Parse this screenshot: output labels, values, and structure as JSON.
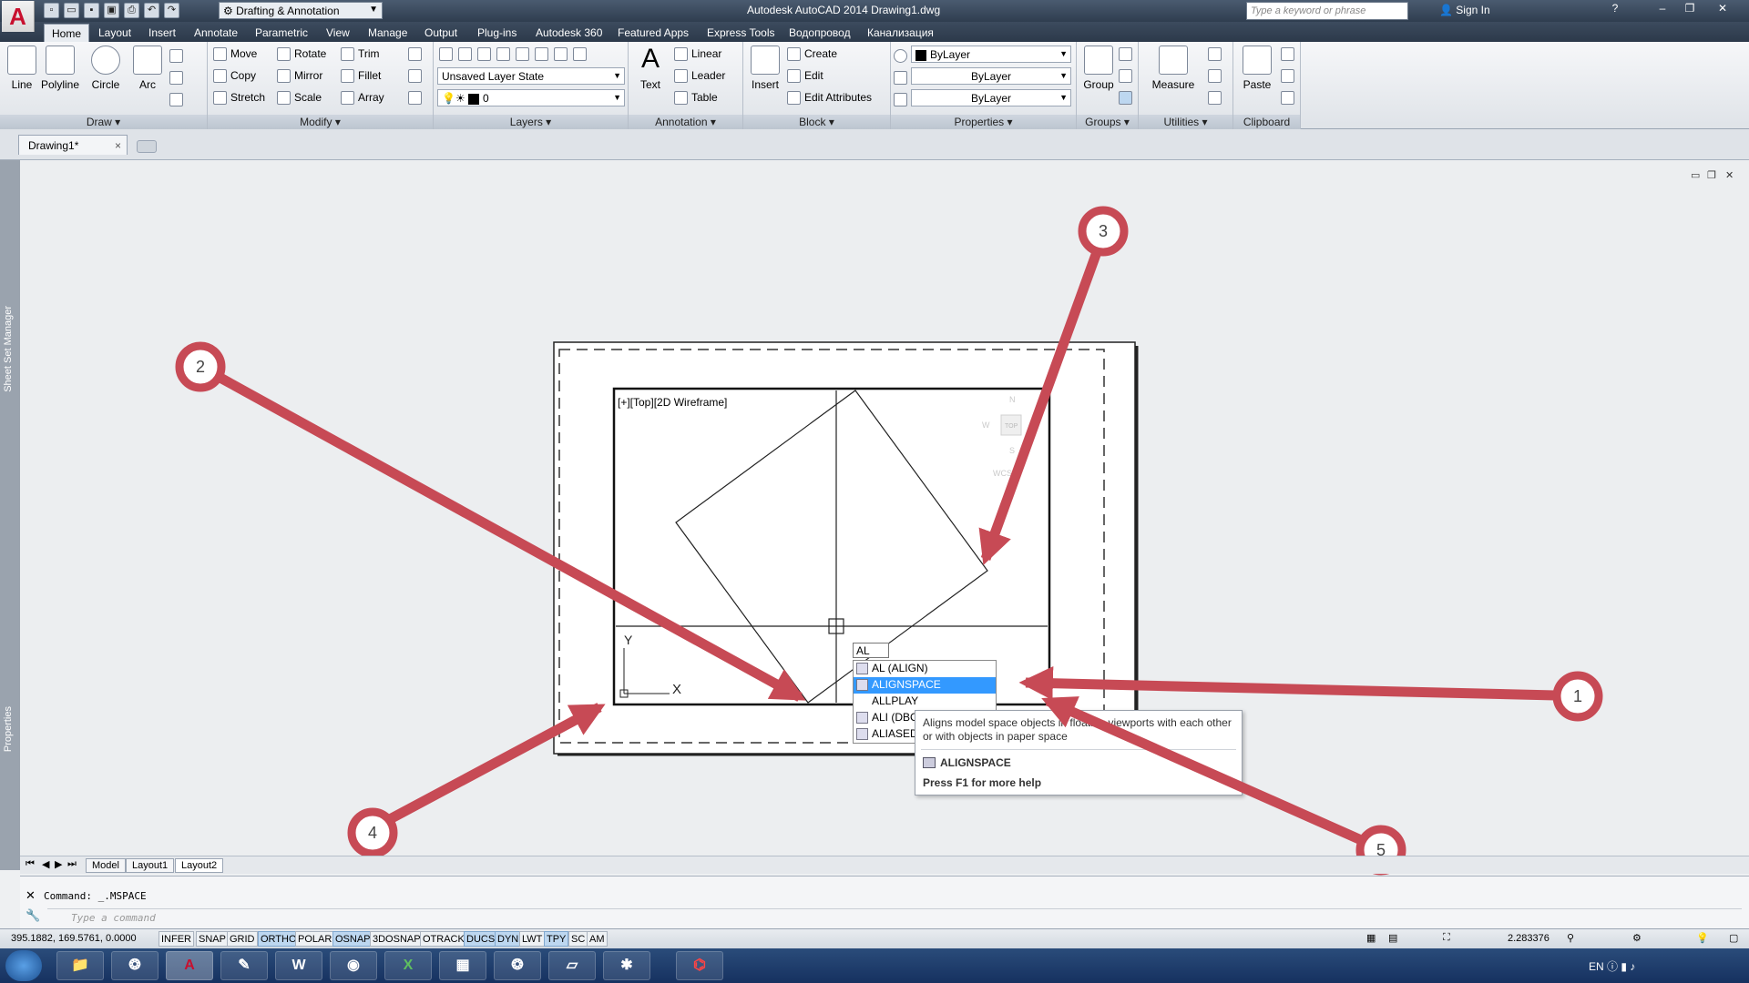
{
  "titlebar": {
    "app_title": "Autodesk AutoCAD 2014    Drawing1.dwg",
    "workspace": "Drafting & Annotation",
    "search_placeholder": "Type a keyword or phrase",
    "sign_in": "Sign In",
    "help": "?"
  },
  "tabs": [
    "Home",
    "Layout",
    "Insert",
    "Annotate",
    "Parametric",
    "View",
    "Manage",
    "Output",
    "Plug-ins",
    "Autodesk 360",
    "Featured Apps",
    "Express Tools",
    "Водопровод",
    "Канализация"
  ],
  "ribbon": {
    "draw": {
      "label": "Draw",
      "line": "Line",
      "polyline": "Polyline",
      "circle": "Circle",
      "arc": "Arc"
    },
    "modify": {
      "label": "Modify",
      "move": "Move",
      "rotate": "Rotate",
      "trim": "Trim",
      "copy": "Copy",
      "mirror": "Mirror",
      "fillet": "Fillet",
      "stretch": "Stretch",
      "scale": "Scale",
      "array": "Array"
    },
    "layers": {
      "label": "Layers",
      "layer_state": "Unsaved Layer State",
      "current_layer": "0"
    },
    "annotation": {
      "label": "Annotation",
      "text": "Text",
      "linear": "Linear",
      "leader": "Leader",
      "table": "Table"
    },
    "block": {
      "label": "Block",
      "insert": "Insert",
      "create": "Create",
      "edit": "Edit",
      "edit_attributes": "Edit Attributes"
    },
    "properties": {
      "label": "Properties",
      "color": "ByLayer",
      "lineweight": "ByLayer",
      "linetype": "ByLayer"
    },
    "groups": {
      "label": "Groups",
      "group": "Group"
    },
    "utilities": {
      "label": "Utilities",
      "measure": "Measure"
    },
    "clipboard": {
      "label": "Clipboard",
      "paste": "Paste"
    }
  },
  "file_tab": {
    "name": "Drawing1*",
    "close": "×"
  },
  "palettes": {
    "sheet_set": "Sheet Set Manager",
    "properties": "Properties"
  },
  "viewport": {
    "label": "[+][Top][2D Wireframe]",
    "viewcube_top": "TOP",
    "viewcube_wcs": "WCS",
    "viewcube_n": "N",
    "viewcube_w": "W",
    "viewcube_s": "S",
    "ucs_y": "Y",
    "ucs_x": "X"
  },
  "layout_tabs": [
    "Model",
    "Layout1",
    "Layout2"
  ],
  "autocomplete": {
    "typed": "AL",
    "items": [
      {
        "label": "AL (ALIGN)",
        "selected": false
      },
      {
        "label": "ALIGNSPACE",
        "selected": true
      },
      {
        "label": "ALLPLAY",
        "selected": false
      },
      {
        "label": "ALI (DBCONNECT)",
        "selected": false
      },
      {
        "label": "ALIASEDIT",
        "selected": false
      }
    ]
  },
  "tooltip": {
    "description": "Aligns model space objects in floating viewports with each other or with objects in paper space",
    "command": "ALIGNSPACE",
    "help": "Press F1 for more help"
  },
  "command_line": {
    "history": "Command: _.MSPACE",
    "placeholder": "Type a command"
  },
  "status": {
    "coords": "395.1882, 169.5761, 0.0000",
    "toggles": [
      {
        "label": "INFER",
        "on": false
      },
      {
        "label": "SNAP",
        "on": false
      },
      {
        "label": "GRID",
        "on": false
      },
      {
        "label": "ORTHO",
        "on": true
      },
      {
        "label": "POLAR",
        "on": false
      },
      {
        "label": "OSNAP",
        "on": true
      },
      {
        "label": "3DOSNAP",
        "on": false
      },
      {
        "label": "OTRACK",
        "on": false
      },
      {
        "label": "DUCS",
        "on": true
      },
      {
        "label": "DYN",
        "on": true
      },
      {
        "label": "LWT",
        "on": false
      },
      {
        "label": "TPY",
        "on": true
      },
      {
        "label": "SC",
        "on": false
      },
      {
        "label": "AM",
        "on": false
      }
    ],
    "scale": "2.283376"
  },
  "taskbar": {
    "language": "EN"
  },
  "callouts": [
    "1",
    "2",
    "3",
    "4",
    "5"
  ],
  "colors": {
    "callout": "#c74a55",
    "accent": "#3399ff",
    "autocad_red": "#c8102e"
  }
}
